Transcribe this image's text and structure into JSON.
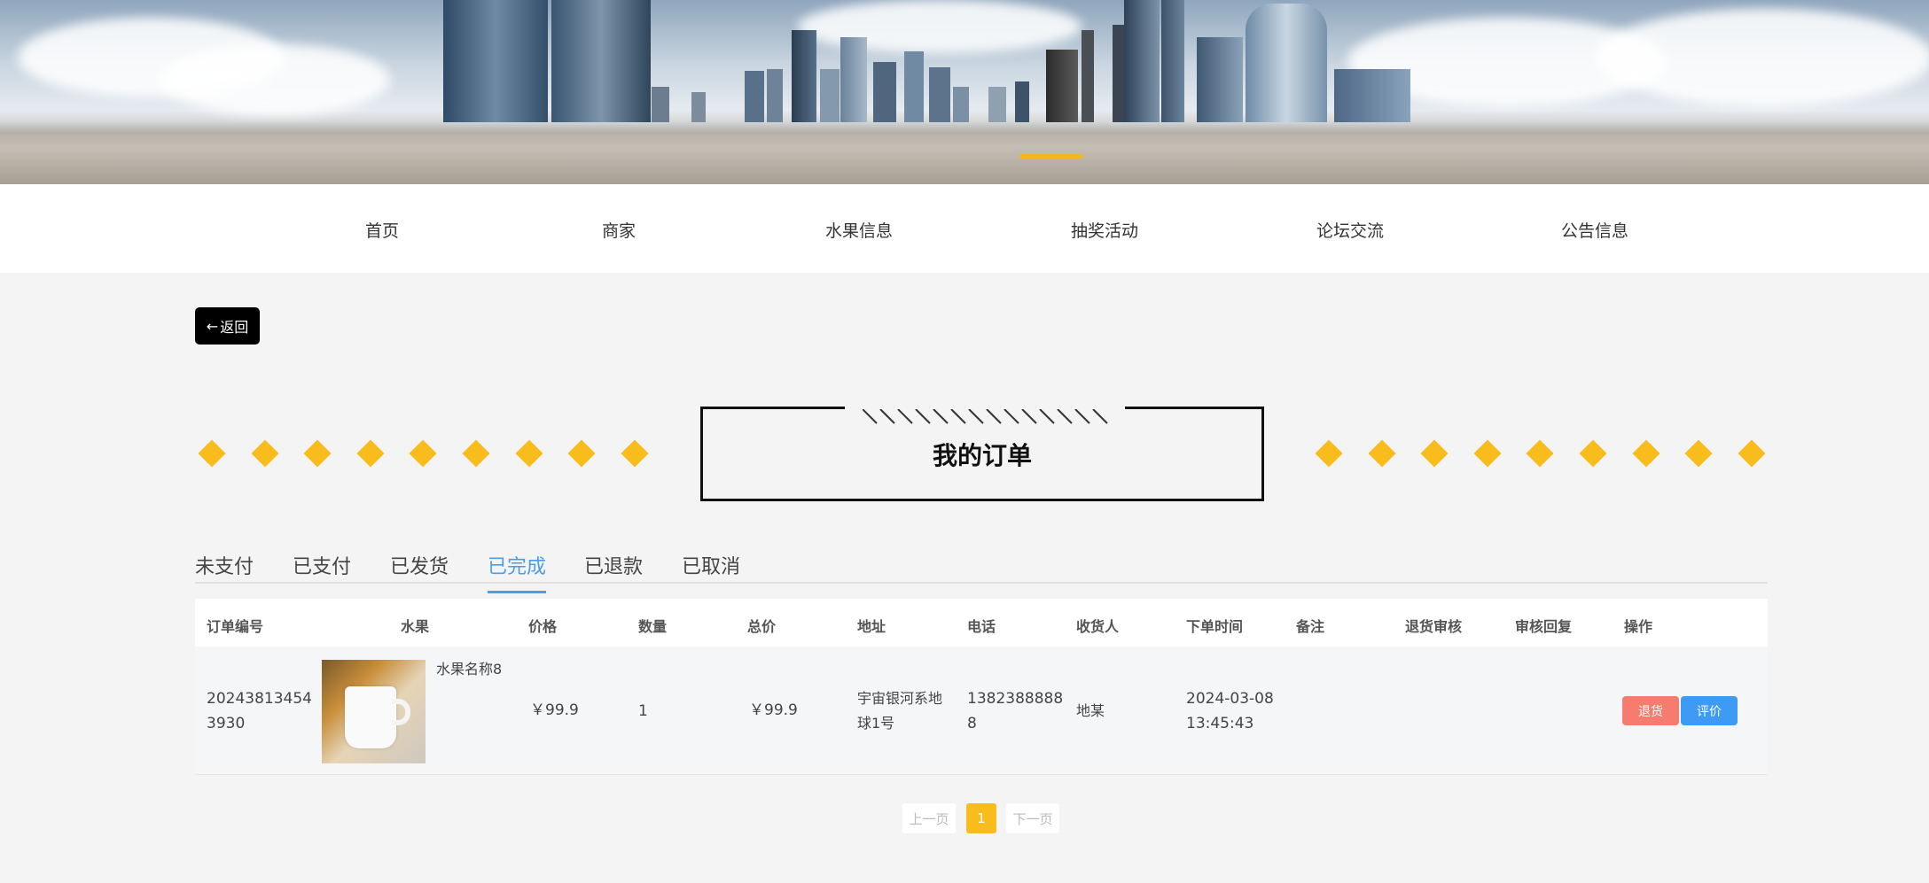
{
  "nav": {
    "items": [
      {
        "label": "首页"
      },
      {
        "label": "商家"
      },
      {
        "label": "水果信息"
      },
      {
        "label": "抽奖活动"
      },
      {
        "label": "论坛交流"
      },
      {
        "label": "公告信息"
      }
    ]
  },
  "back_button": {
    "icon": "arrow-left-icon",
    "label": "返回"
  },
  "page_title": "我的订单",
  "tabs": [
    {
      "label": "未支付",
      "active": false
    },
    {
      "label": "已支付",
      "active": false
    },
    {
      "label": "已发货",
      "active": false
    },
    {
      "label": "已完成",
      "active": true
    },
    {
      "label": "已退款",
      "active": false
    },
    {
      "label": "已取消",
      "active": false
    }
  ],
  "table": {
    "headers": [
      "订单编号",
      "水果",
      "价格",
      "数量",
      "总价",
      "地址",
      "电话",
      "收货人",
      "下单时间",
      "备注",
      "退货审核",
      "审核回复",
      "操作"
    ],
    "rows": [
      {
        "order_no_line1": "20243813454",
        "order_no_line2": "3930",
        "fruit_name": "水果名称8",
        "price": "￥99.9",
        "quantity": "1",
        "total": "￥99.9",
        "address_line1": "宇宙银河系地",
        "address_line2": "球1号",
        "phone_line1": "1382388888",
        "phone_line2": "8",
        "receiver": "地某",
        "time_line1": "2024-03-08",
        "time_line2": "13:45:43",
        "remark": "",
        "return_review": "",
        "review_reply": "",
        "actions": {
          "refund": "退货",
          "review": "评价"
        }
      }
    ]
  },
  "pagination": {
    "prev": "上一页",
    "current": "1",
    "next": "下一页"
  },
  "colors": {
    "accent": "#f8bd1c",
    "active_tab": "#4a9ee6",
    "refund": "#f57c6f",
    "review": "#3d9af5"
  }
}
